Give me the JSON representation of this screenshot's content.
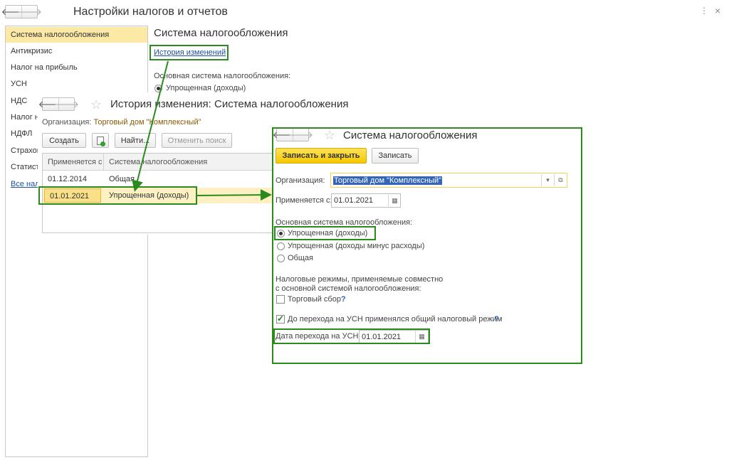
{
  "main": {
    "title": "Настройки налогов и отчетов",
    "menu_icon": "⋮",
    "close_icon": "×",
    "sidebar": [
      "Система налогообложения",
      "Антикризис",
      "Налог на прибыль",
      "УСН",
      "НДС",
      "Налог н",
      "НДФЛ",
      "Страхов",
      "Статист",
      "Все нал"
    ],
    "section_title": "Система налогообложения",
    "history_link": "История изменений",
    "main_system_label": "Основная система налогообложения:",
    "radio_selected": "Упрощенная (доходы)"
  },
  "history": {
    "title": "История изменения: Система налогообложения",
    "org_label": "Организация:",
    "org_value": "Торговый дом \"Комплексный\"",
    "create_button": "Создать",
    "find_button": "Найти...",
    "cancel_search_button": "Отменить поиск",
    "columns": [
      "Применяется с",
      "Система налогообложения"
    ],
    "rows": [
      {
        "date": "01.12.2014",
        "system": "Общая"
      },
      {
        "date": "01.01.2021",
        "system": "Упрощенная (доходы)"
      }
    ]
  },
  "record": {
    "title": "Система налогообложения",
    "save_close_button": "Записать и закрыть",
    "save_button": "Записать",
    "org_label": "Организация:",
    "org_value": "Торговый дом \"Комплексный\"",
    "applies_label": "Применяется с:",
    "applies_value": "01.01.2021",
    "main_system_label": "Основная система налогообложения:",
    "options": [
      "Упрощенная (доходы)",
      "Упрощенная (доходы минус расходы)",
      "Общая"
    ],
    "selected_option": 0,
    "regimes_label_1": "Налоговые режимы, применяемые совместно",
    "regimes_label_2": "с основной системой налогообложения:",
    "trade_fee_label": "Торговый сбор",
    "help_mark": "?",
    "transition_label": "До перехода на УСН применялся общий налоговый режим",
    "transition_date_label": "Дата перехода на УСН:",
    "transition_date_value": "01.01.2021"
  },
  "colors": {
    "accent_green": "#2b8a1e",
    "highlight_yellow": "#fbe9a5",
    "button_yellow": "#f5c800",
    "link_blue": "#1d4fa5"
  }
}
